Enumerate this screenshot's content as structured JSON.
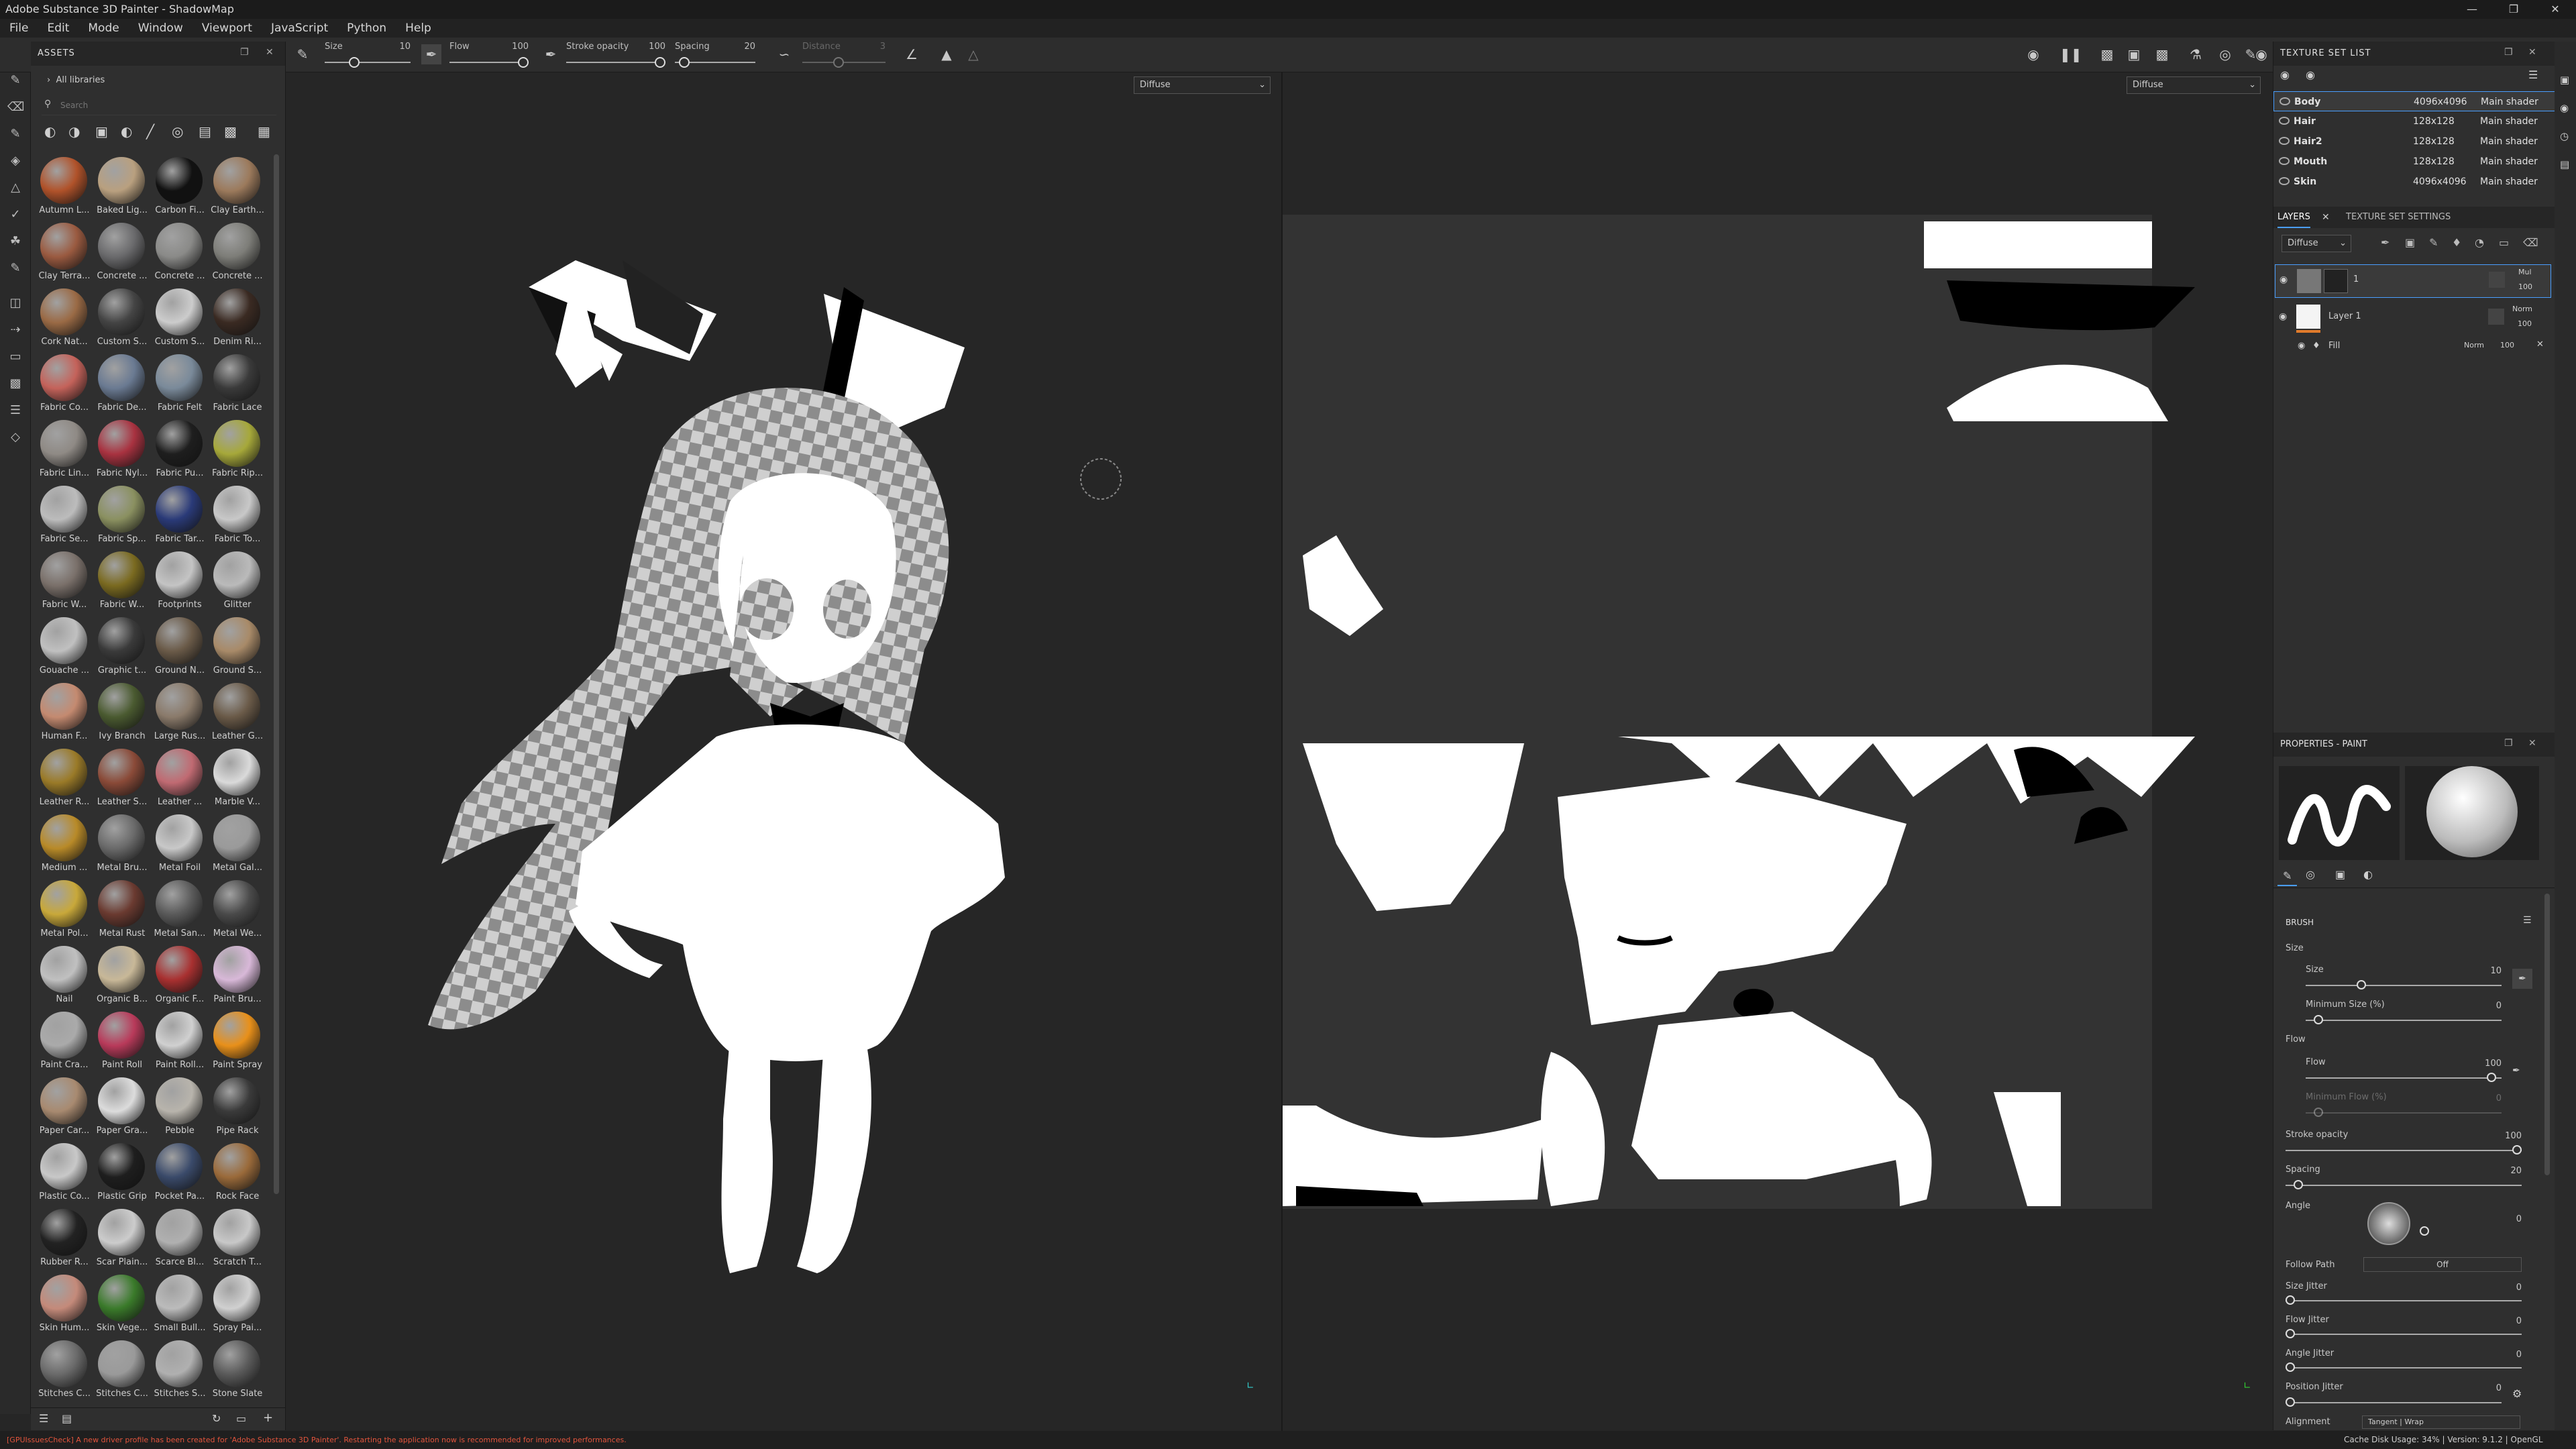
{
  "window": {
    "title": "Adobe Substance 3D Painter - ShadowMap"
  },
  "menu": [
    "File",
    "Edit",
    "Mode",
    "Window",
    "Viewport",
    "JavaScript",
    "Python",
    "Help"
  ],
  "toolbar": {
    "size_label": "Size",
    "size_value": "10",
    "flow_label": "Flow",
    "flow_value": "100",
    "stroke_opacity_label": "Stroke opacity",
    "stroke_opacity_value": "100",
    "spacing_label": "Spacing",
    "spacing_value": "20",
    "distance_label": "Distance",
    "distance_value": "3"
  },
  "assets": {
    "title": "ASSETS",
    "library": "All libraries",
    "search_placeholder": "Search",
    "items": [
      {
        "label": "Autumn L...",
        "color": "#b0522a"
      },
      {
        "label": "Baked Lig...",
        "color": "#b9a07f"
      },
      {
        "label": "Carbon Fi...",
        "color": "#111111"
      },
      {
        "label": "Clay Earth...",
        "color": "#9c7a5c"
      },
      {
        "label": "Clay Terra...",
        "color": "#9a5a40"
      },
      {
        "label": "Concrete ...",
        "color": "#6a6a6c"
      },
      {
        "label": "Concrete ...",
        "color": "#8a8a88"
      },
      {
        "label": "Concrete ...",
        "color": "#7d7d78"
      },
      {
        "label": "Cork Nat...",
        "color": "#9a6a45"
      },
      {
        "label": "Custom S...",
        "color": "#444444"
      },
      {
        "label": "Custom S...",
        "color": "#cccccc"
      },
      {
        "label": "Denim Ri...",
        "color": "#3a2a22"
      },
      {
        "label": "Fabric Co...",
        "color": "#c4625a"
      },
      {
        "label": "Fabric De...",
        "color": "#6a7a92"
      },
      {
        "label": "Fabric Felt",
        "color": "#7a8a9a"
      },
      {
        "label": "Fabric Lace",
        "color": "#3a3a3a"
      },
      {
        "label": "Fabric Lin...",
        "color": "#8f8a85"
      },
      {
        "label": "Fabric Nyl...",
        "color": "#a83240"
      },
      {
        "label": "Fabric Pu...",
        "color": "#1e1e1e"
      },
      {
        "label": "Fabric Rip...",
        "color": "#a6a83a"
      },
      {
        "label": "Fabric Se...",
        "color": "#bcbcbc"
      },
      {
        "label": "Fabric Sp...",
        "color": "#8a9060"
      },
      {
        "label": "Fabric Tar...",
        "color": "#2a3a78"
      },
      {
        "label": "Fabric To...",
        "color": "#c8c8c8"
      },
      {
        "label": "Fabric W...",
        "color": "#7a706a"
      },
      {
        "label": "Fabric W...",
        "color": "#7a6a20"
      },
      {
        "label": "Footprints",
        "color": "#c4c4c4"
      },
      {
        "label": "Glitter",
        "color": "#bababa"
      },
      {
        "label": "Gouache ...",
        "color": "#c0c0c0"
      },
      {
        "label": "Graphic t...",
        "color": "#3a3a3a"
      },
      {
        "label": "Ground N...",
        "color": "#6a5a48"
      },
      {
        "label": "Ground S...",
        "color": "#a88a68"
      },
      {
        "label": "Human F...",
        "color": "#c48a70"
      },
      {
        "label": "Ivy Branch",
        "color": "#4a5a30"
      },
      {
        "label": "Large Rus...",
        "color": "#8a7a6a"
      },
      {
        "label": "Leather G...",
        "color": "#6a5a48"
      },
      {
        "label": "Leather R...",
        "color": "#9a7a28"
      },
      {
        "label": "Leather S...",
        "color": "#8a4a38"
      },
      {
        "label": "Leather ...",
        "color": "#c06a72"
      },
      {
        "label": "Marble V...",
        "color": "#dadada"
      },
      {
        "label": "Medium ...",
        "color": "#b88a28"
      },
      {
        "label": "Metal Bru...",
        "color": "#6a6a6a"
      },
      {
        "label": "Metal Foil",
        "color": "#c8c8c8"
      },
      {
        "label": "Metal Gal...",
        "color": "#9a9a9a"
      },
      {
        "label": "Metal Pol...",
        "color": "#c8a83a"
      },
      {
        "label": "Metal Rust",
        "color": "#6a3a30"
      },
      {
        "label": "Metal San...",
        "color": "#5a5a5a"
      },
      {
        "label": "Metal We...",
        "color": "#4a4a4a"
      },
      {
        "label": "Nail",
        "color": "#c0c0c0"
      },
      {
        "label": "Organic B...",
        "color": "#c8b898"
      },
      {
        "label": "Organic F...",
        "color": "#a83030"
      },
      {
        "label": "Paint Bru...",
        "color": "#d8b8d8"
      },
      {
        "label": "Paint Cra...",
        "color": "#aaaaaa"
      },
      {
        "label": "Paint Roll",
        "color": "#b83a5a"
      },
      {
        "label": "Paint Roll...",
        "color": "#d0d0d0"
      },
      {
        "label": "Paint Spray",
        "color": "#e8901a"
      },
      {
        "label": "Paper Car...",
        "color": "#a88a70"
      },
      {
        "label": "Paper Gra...",
        "color": "#dcdcdc"
      },
      {
        "label": "Pebble",
        "color": "#b8b4ac"
      },
      {
        "label": "Pipe Rack",
        "color": "#3a3a3a"
      },
      {
        "label": "Plastic Co...",
        "color": "#c8c8c8"
      },
      {
        "label": "Plastic Grip",
        "color": "#1e1e1e"
      },
      {
        "label": "Pocket Pa...",
        "color": "#3a4a6a"
      },
      {
        "label": "Rock Face",
        "color": "#9a6a3a"
      },
      {
        "label": "Rubber R...",
        "color": "#222222"
      },
      {
        "label": "Scar Plain...",
        "color": "#cccccc"
      },
      {
        "label": "Scarce Bl...",
        "color": "#b0b0b0"
      },
      {
        "label": "Scratch T...",
        "color": "#c8c8c8"
      },
      {
        "label": "Skin Hum...",
        "color": "#c48a7a"
      },
      {
        "label": "Skin Vege...",
        "color": "#3a7a2a"
      },
      {
        "label": "Small Bull...",
        "color": "#bbbbbb"
      },
      {
        "label": "Spray Pai...",
        "color": "#d0d0d0"
      },
      {
        "label": "Stitches C...",
        "color": "#6a6a6a"
      },
      {
        "label": "Stitches C...",
        "color": "#9a9a9a"
      },
      {
        "label": "Stitches S...",
        "color": "#b0b0b0"
      },
      {
        "label": "Stone Slate",
        "color": "#5a5a5a"
      }
    ]
  },
  "viewport3d": {
    "channel": "Diffuse"
  },
  "viewportuv": {
    "channel": "Diffuse"
  },
  "texture_set_list": {
    "title": "TEXTURE SET LIST",
    "rows": [
      {
        "name": "Body",
        "resolution": "4096x4096",
        "shader": "Main shader"
      },
      {
        "name": "Hair",
        "resolution": "128x128",
        "shader": "Main shader"
      },
      {
        "name": "Hair2",
        "resolution": "128x128",
        "shader": "Main shader"
      },
      {
        "name": "Mouth",
        "resolution": "128x128",
        "shader": "Main shader"
      },
      {
        "name": "Skin",
        "resolution": "4096x4096",
        "shader": "Main shader"
      }
    ]
  },
  "layers": {
    "tab_layers": "LAYERS",
    "tab_settings": "TEXTURE SET SETTINGS",
    "channel": "Diffuse",
    "items": [
      {
        "name": "1",
        "blend": "Mul",
        "opacity": "100"
      },
      {
        "name": "Layer 1",
        "blend": "Norm",
        "opacity": "100"
      },
      {
        "name": "Fill",
        "blend": "Norm",
        "opacity": "100"
      }
    ]
  },
  "properties": {
    "title": "PROPERTIES - PAINT",
    "section": "BRUSH",
    "size_group": "Size",
    "size_label": "Size",
    "size_value": "10",
    "min_size_label": "Minimum Size (%)",
    "min_size_value": "0",
    "flow_group": "Flow",
    "flow_label": "Flow",
    "flow_value": "100",
    "min_flow_label": "Minimum Flow (%)",
    "min_flow_value": "0",
    "stroke_opacity_label": "Stroke opacity",
    "stroke_opacity_value": "100",
    "spacing_label": "Spacing",
    "spacing_value": "20",
    "angle_label": "Angle",
    "angle_value": "0",
    "follow_path_label": "Follow Path",
    "follow_path_value": "Off",
    "size_jitter_label": "Size Jitter",
    "size_jitter_value": "0",
    "flow_jitter_label": "Flow Jitter",
    "flow_jitter_value": "0",
    "angle_jitter_label": "Angle Jitter",
    "angle_jitter_value": "0",
    "position_jitter_label": "Position Jitter",
    "position_jitter_value": "0",
    "alignment_label": "Alignment",
    "alignment_value1": "Tangent",
    "alignment_value2": "Wrap"
  },
  "status": {
    "message": "[GPUIssuesCheck] A new driver profile has been created for 'Adobe Substance 3D Painter'. Restarting the application now is recommended for improved performances.",
    "cache": "Cache Disk Usage:  34% | Version: 9.1.2 | OpenGL"
  }
}
